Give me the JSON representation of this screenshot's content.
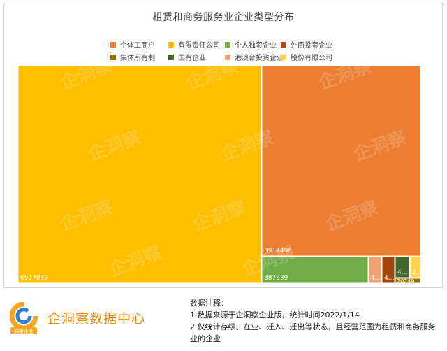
{
  "chart_data": {
    "type": "treemap",
    "title": "租赁和商务服务业企业类型分布",
    "series": [
      {
        "name": "有限责任公司",
        "value": 6917039,
        "color": "#fdbf00",
        "label": "6917039"
      },
      {
        "name": "个体工商户",
        "value": 3914496,
        "color": "#ed7d31",
        "label": "3914496"
      },
      {
        "name": "个人独资企业",
        "value": 387339,
        "color": "#70ad47",
        "label": "387339"
      },
      {
        "name": "港澳台投资企业",
        "color": "#f4a070",
        "label": "4..."
      },
      {
        "name": "外商投资企业",
        "color": "#9e480e",
        "label": "4..."
      },
      {
        "name": "国有企业",
        "color": "#43682b",
        "label": "4..."
      },
      {
        "name": "股份有限公司",
        "color": "#ffd34d",
        "label": "2..."
      },
      {
        "name": "集体所有制",
        "value": 20249,
        "color": "#997300",
        "label": "20249"
      }
    ],
    "legend": {
      "position": "top",
      "order": [
        "个体工商户",
        "有限责任公司",
        "个人独资企业",
        "外商投资企业",
        "集体所有制",
        "国有企业",
        "港澳台投资企业",
        "股份有限公司"
      ]
    }
  },
  "footer": {
    "brand": "企洞察数据中心",
    "logo_text": "洞察企业",
    "notes": [
      "数据注释：",
      "1.数据来源于企洞察企业版，统计时间2022/1/14",
      "2.仅统计存续、在业、迁入、迁出等状态，且经营范围为租赁和商务服务业的企业"
    ]
  },
  "watermark": {
    "text": "企洞察"
  }
}
